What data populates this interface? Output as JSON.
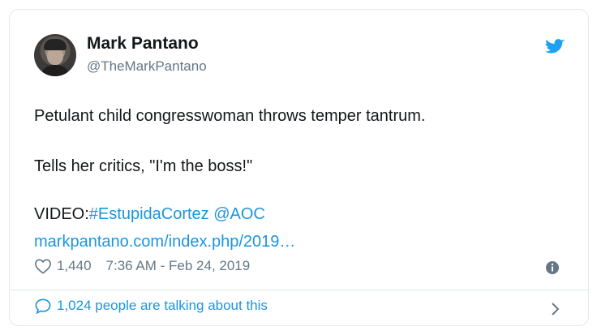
{
  "author": {
    "display_name": "Mark Pantano",
    "handle": "@TheMarkPantano"
  },
  "tweet": {
    "line1": "Petulant child congresswoman throws temper tantrum.",
    "line2": "Tells her critics, \"I'm the boss!\"",
    "video_label": "VIDEO:",
    "hashtag": "#EstupidaCortez",
    "mention": "@AOC",
    "url": "markpantano.com/index.php/2019…"
  },
  "meta": {
    "likes": "1,440",
    "timestamp": "7:36 AM - Feb 24, 2019"
  },
  "footer": {
    "conversation_text": "1,024 people are talking about this"
  },
  "icons": {
    "bird": "twitter-bird-icon",
    "heart": "heart-icon",
    "info": "info-icon",
    "bubble": "speech-bubble-icon",
    "chevron": "chevron-right-icon"
  },
  "colors": {
    "accent": "#1b95e0",
    "secondary_text": "#657786",
    "border": "#e1e8ed"
  }
}
